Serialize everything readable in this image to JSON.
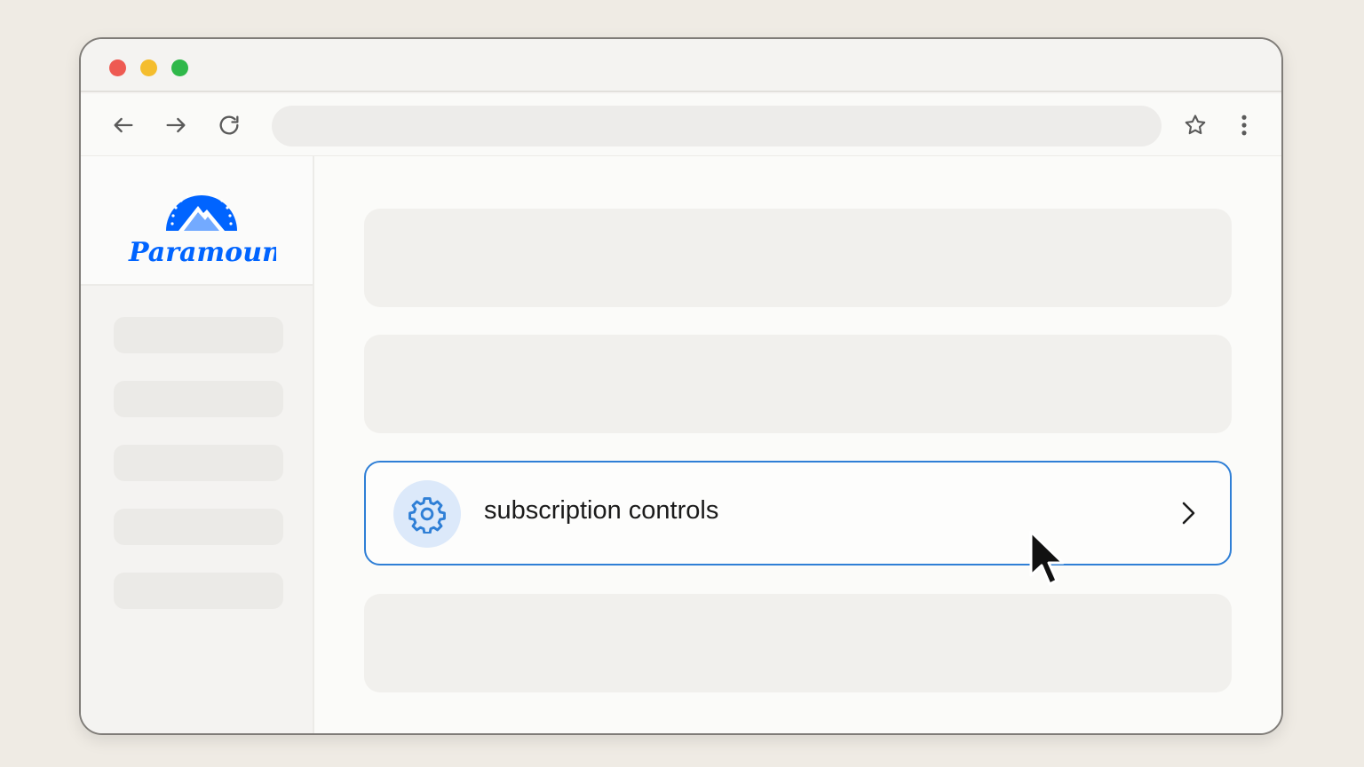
{
  "browser": {
    "url": "",
    "traffic_lights": [
      "close",
      "minimize",
      "zoom"
    ]
  },
  "brand": {
    "name": "Paramount+",
    "color": "#0064ff"
  },
  "menu_row": {
    "label": "subscription controls",
    "icon": "gear-icon",
    "accent": "#2f7fd6"
  },
  "icons": {
    "back": "arrow-left-icon",
    "forward": "arrow-right-icon",
    "reload": "reload-icon",
    "bookmark": "star-icon",
    "menu": "kebab-menu-icon",
    "row_chevron": "chevron-right-icon"
  }
}
